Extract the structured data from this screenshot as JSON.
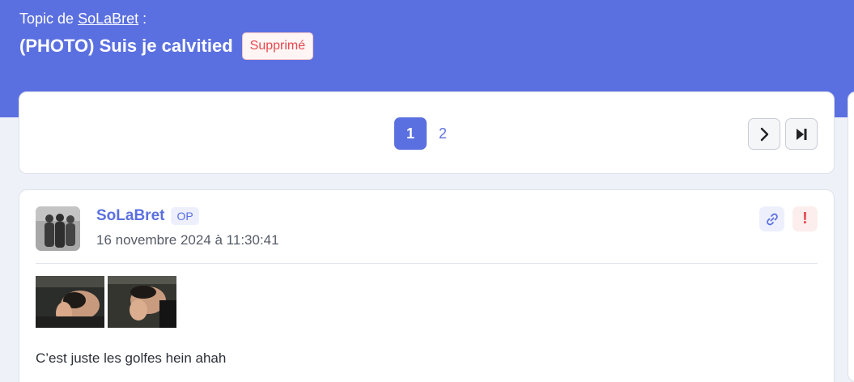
{
  "header": {
    "topic_prefix": "Topic de",
    "author_link": "SoLaBret",
    "topic_suffix": ":",
    "title": "(PHOTO) Suis je calvitied",
    "deleted_badge": "Supprimé"
  },
  "pagination": {
    "pages": [
      "1",
      "2"
    ],
    "active_page": "1"
  },
  "post": {
    "author": "SoLaBret",
    "op_badge": "OP",
    "date": "16 novembre 2024 à 11:30:41",
    "message": "C’est juste les golfes hein ahah"
  },
  "colors": {
    "accent": "#5b70e0",
    "danger": "#e5484d"
  }
}
